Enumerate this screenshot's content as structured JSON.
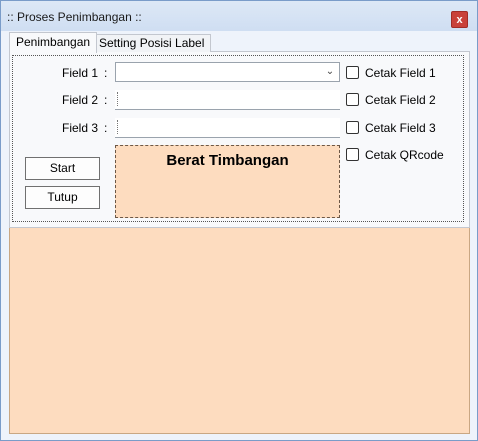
{
  "window": {
    "title": ":: Proses Penimbangan ::",
    "close_label": "x"
  },
  "tabs": [
    {
      "label": "Penimbangan",
      "active": true
    },
    {
      "label": "Setting Posisi Label",
      "active": false
    }
  ],
  "form": {
    "colon": ":",
    "field1": {
      "label": "Field 1",
      "value": ""
    },
    "field2": {
      "label": "Field 2",
      "value": ""
    },
    "field3": {
      "label": "Field 3",
      "value": ""
    }
  },
  "checkboxes": [
    {
      "label": "Cetak Field 1",
      "checked": false
    },
    {
      "label": "Cetak Field 2",
      "checked": false
    },
    {
      "label": "Cetak Field 3",
      "checked": false
    },
    {
      "label": "Cetak QRcode",
      "checked": false
    }
  ],
  "buttons": {
    "start": "Start",
    "tutup": "Tutup"
  },
  "weight_panel": {
    "title": "Berat Timbangan"
  },
  "colors": {
    "accent_fill": "#fddcbf",
    "close_button": "#c9413a"
  }
}
